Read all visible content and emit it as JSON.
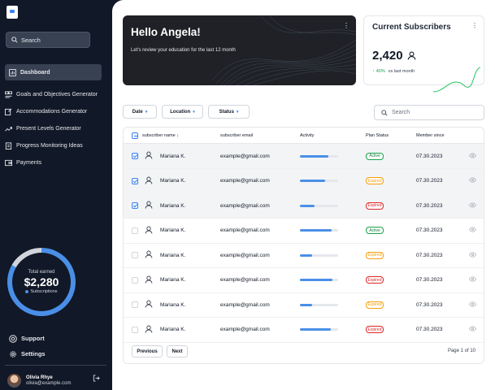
{
  "sidebar": {
    "search_label": "Search",
    "items": [
      {
        "label": "Dashboard",
        "icon": "chart-icon"
      },
      {
        "label": "Goals and Objectives Generator",
        "icon": "layers-icon"
      },
      {
        "label": "Accommodations Generator",
        "icon": "edit-doc-icon"
      },
      {
        "label": "Present Levels Generator",
        "icon": "trend-icon"
      },
      {
        "label": "Progress Monitoring Ideas",
        "icon": "clipboard-icon"
      },
      {
        "label": "Payments",
        "icon": "wallet-icon"
      }
    ],
    "earned": {
      "label": "Total earned",
      "value": "$2,280",
      "sub": "Subscriptions",
      "progress_pct": 83
    },
    "bottom": [
      {
        "label": "Support",
        "icon": "support-icon"
      },
      {
        "label": "Settings",
        "icon": "gear-icon"
      }
    ],
    "user": {
      "name": "Olivia Rhye",
      "email": "olivia@example.com"
    }
  },
  "hero": {
    "title": "Hello Angela!",
    "subtitle": "Let's review your education  for the last 12 month"
  },
  "subscribers": {
    "title": "Current Subscribers",
    "value": "2,420",
    "change": "40%",
    "change_note": "vs last month"
  },
  "filters": [
    {
      "label": "Date"
    },
    {
      "label": "Location"
    },
    {
      "label": "Status"
    }
  ],
  "search_placeholder": "Search",
  "table": {
    "headers": {
      "name": "subscriber name",
      "email": "subscriber email",
      "activity": "Activity",
      "status": "Plan Status",
      "since": "Member since"
    },
    "rows": [
      {
        "name": "Mariana K.",
        "email": "example@gmail.com",
        "activity": 0.75,
        "status": "Active",
        "status_class": "Active",
        "since": "07.30.2023",
        "selected": true
      },
      {
        "name": "Mariana K.",
        "email": "example@gmail.com",
        "activity": 0.65,
        "status": "Expired",
        "status_class": "expired",
        "since": "07.30.2023",
        "selected": true
      },
      {
        "name": "Mariana K.",
        "email": "example@gmail.com",
        "activity": 0.38,
        "status": "Expired",
        "status_class": "Expired",
        "since": "07.30.2023",
        "selected": true
      },
      {
        "name": "Mariana K.",
        "email": "example@gmail.com",
        "activity": 0.82,
        "status": "Active",
        "status_class": "Active",
        "since": "07.30.2023",
        "selected": false
      },
      {
        "name": "Mariana K.",
        "email": "example@gmail.com",
        "activity": 0.32,
        "status": "Expired",
        "status_class": "expired",
        "since": "07.30.2023",
        "selected": false
      },
      {
        "name": "Mariana K.",
        "email": "example@gmail.com",
        "activity": 0.85,
        "status": "Expired",
        "status_class": "Expired",
        "since": "07.30.2023",
        "selected": false
      },
      {
        "name": "Mariana K.",
        "email": "example@gmail.com",
        "activity": 0.32,
        "status": "Expired",
        "status_class": "expired",
        "since": "07.30.2023",
        "selected": false
      },
      {
        "name": "Mariana K.",
        "email": "example@gmail.com",
        "activity": 0.8,
        "status": "Expired",
        "status_class": "Expired",
        "since": "07.30.2023",
        "selected": false
      }
    ]
  },
  "pager": {
    "previous": "Previous",
    "next": "Next",
    "info": "Page 1 of 10"
  }
}
